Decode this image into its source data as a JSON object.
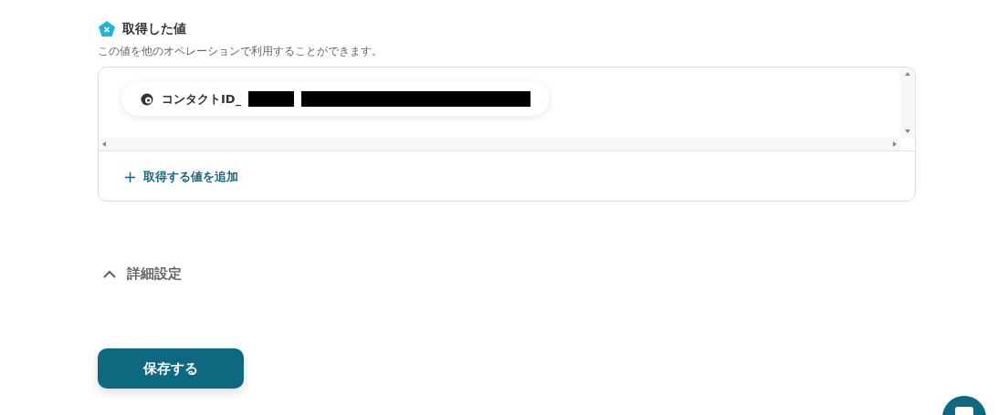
{
  "section": {
    "title": "取得した値",
    "description": "この値を他のオペレーションで利用することができます。"
  },
  "values": [
    {
      "label": "コンタクトID_",
      "redacted": true
    }
  ],
  "add_button": {
    "icon": "+",
    "label": "取得する値を追加"
  },
  "advanced": {
    "label": "詳細設定",
    "expanded": true
  },
  "save_button": {
    "label": "保存する"
  }
}
